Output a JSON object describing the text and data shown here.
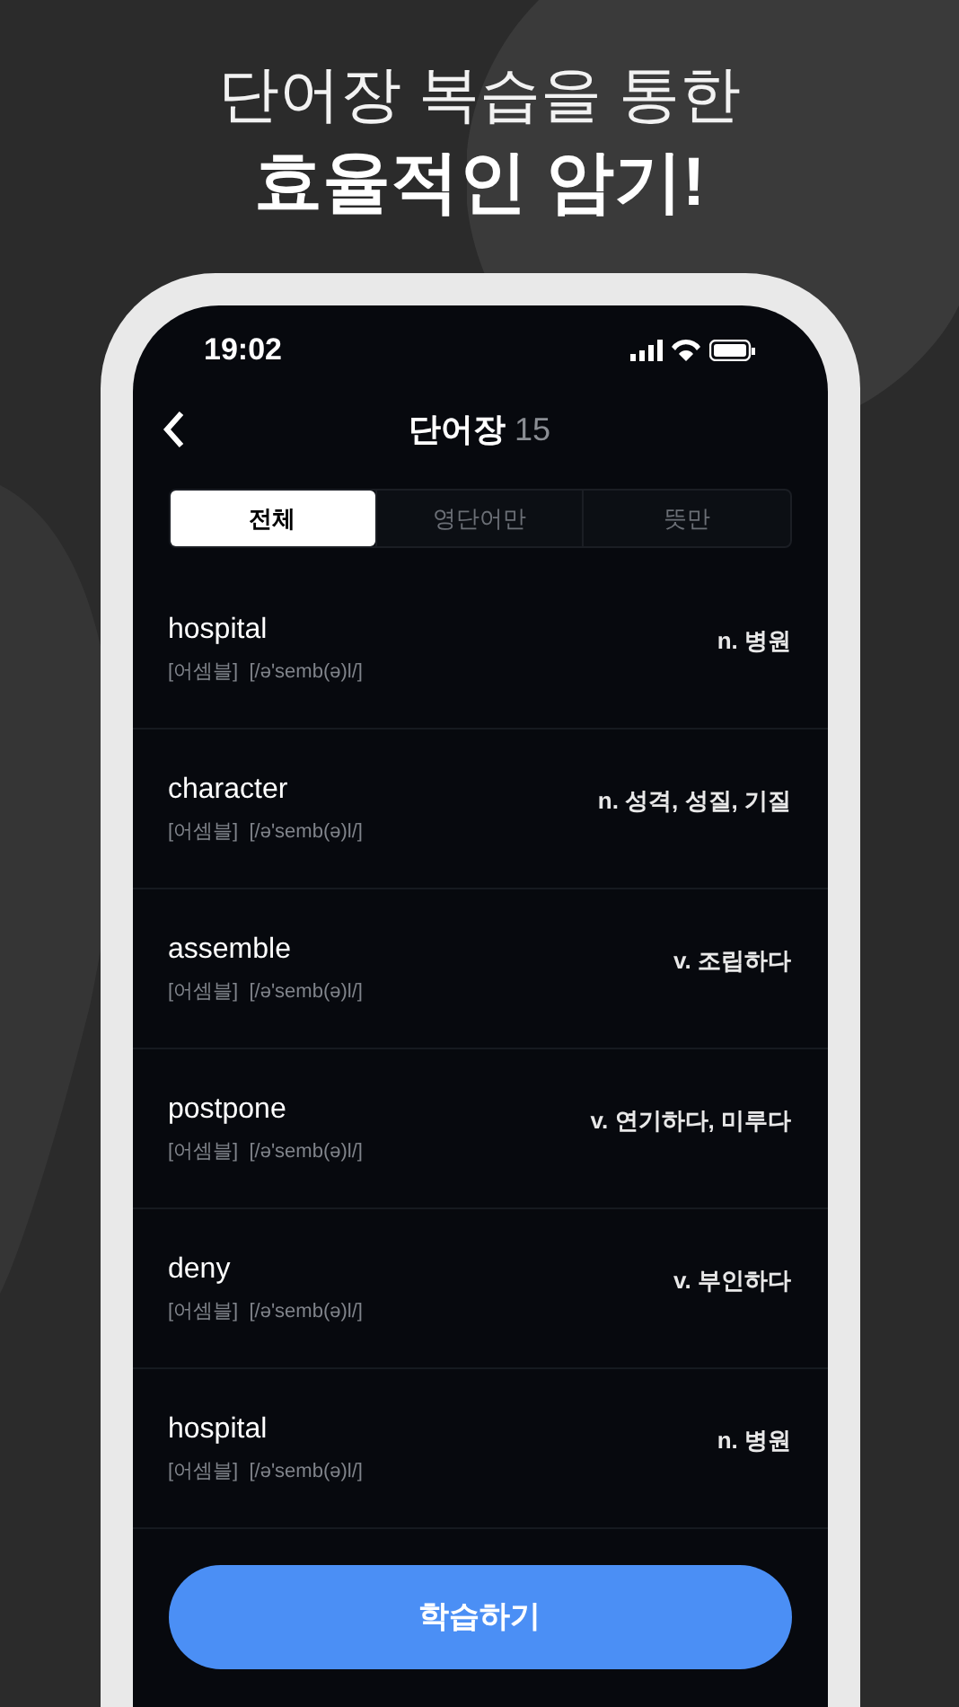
{
  "headline": {
    "line_1": "단어장 복습을 통한",
    "line_2": "효율적인 암기!"
  },
  "status_bar": {
    "time": "19:02"
  },
  "header": {
    "title": "단어장",
    "count": "15"
  },
  "tabs": [
    {
      "label": "전체",
      "selected": true
    },
    {
      "label": "영단어만",
      "selected": false
    },
    {
      "label": "뜻만",
      "selected": false
    }
  ],
  "words": [
    {
      "word": "hospital",
      "pronunciation": "[어셈블]  [/ə'semb(ə)l/]",
      "meaning": "n. 병원"
    },
    {
      "word": "character",
      "pronunciation": "[어셈블]  [/ə'semb(ə)l/]",
      "meaning": "n. 성격, 성질, 기질"
    },
    {
      "word": "assemble",
      "pronunciation": "[어셈블]  [/ə'semb(ə)l/]",
      "meaning": "v. 조립하다"
    },
    {
      "word": "postpone",
      "pronunciation": "[어셈블]  [/ə'semb(ə)l/]",
      "meaning": "v. 연기하다, 미루다"
    },
    {
      "word": "deny",
      "pronunciation": "[어셈블]  [/ə'semb(ə)l/]",
      "meaning": "v. 부인하다"
    },
    {
      "word": "hospital",
      "pronunciation": "[어셈블]  [/ə'semb(ə)l/]",
      "meaning": "n. 병원"
    }
  ],
  "study_button": "학습하기"
}
